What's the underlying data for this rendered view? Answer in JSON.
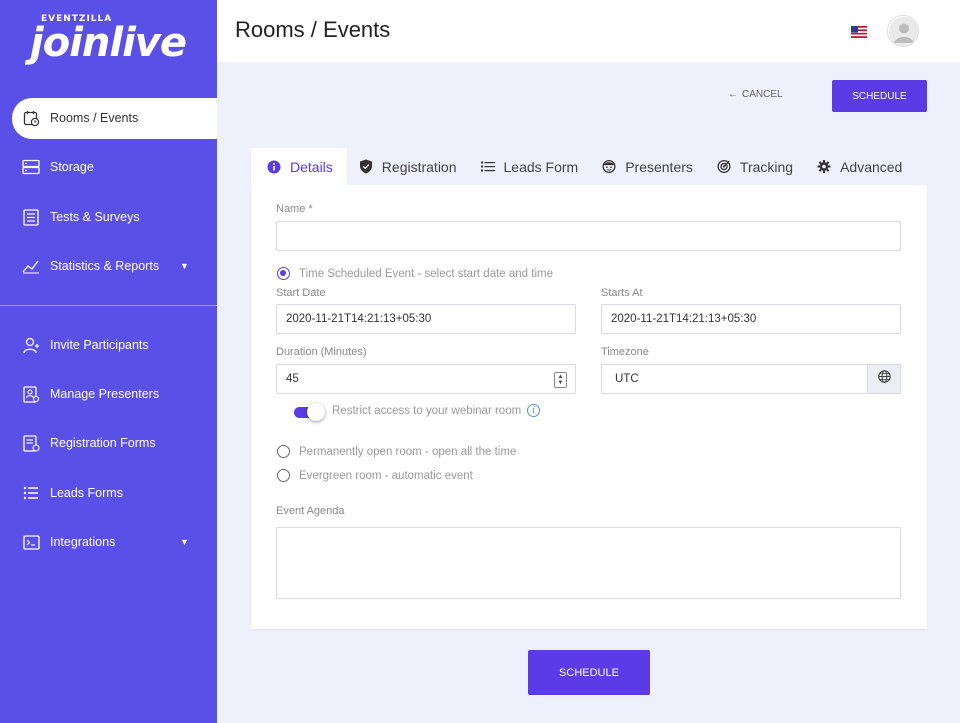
{
  "brand": {
    "small": "EVENTZILLA",
    "big": "joinlive"
  },
  "sidebar": {
    "items": [
      {
        "label": "Rooms / Events",
        "icon": "calendar-clock-icon"
      },
      {
        "label": "Storage",
        "icon": "storage-icon"
      },
      {
        "label": "Tests & Surveys",
        "icon": "checklist-icon"
      },
      {
        "label": "Statistics & Reports",
        "icon": "chart-icon"
      },
      {
        "label": "Invite Participants",
        "icon": "add-user-icon"
      },
      {
        "label": "Manage Presenters",
        "icon": "presenter-icon"
      },
      {
        "label": "Registration Forms",
        "icon": "form-icon"
      },
      {
        "label": "Leads Forms",
        "icon": "list-icon"
      },
      {
        "label": "Integrations",
        "icon": "terminal-icon"
      }
    ]
  },
  "header": {
    "title": "Rooms / Events"
  },
  "actions": {
    "cancel": "CANCEL",
    "schedule": "SCHEDULE"
  },
  "tabs": [
    {
      "label": "Details",
      "icon": "info-icon"
    },
    {
      "label": "Registration",
      "icon": "shield-icon"
    },
    {
      "label": "Leads Form",
      "icon": "list-icon"
    },
    {
      "label": "Presenters",
      "icon": "face-icon"
    },
    {
      "label": "Tracking",
      "icon": "tracking-icon"
    },
    {
      "label": "Advanced",
      "icon": "gear-icon"
    }
  ],
  "form": {
    "name_label": "Name *",
    "name_value": "",
    "opt_scheduled": "Time Scheduled Event - select start date and time",
    "start_date_label": "Start Date",
    "start_date_value": "2020-11-21T14:21:13+05:30",
    "starts_at_label": "Starts At",
    "starts_at_value": "2020-11-21T14:21:13+05:30",
    "duration_label": "Duration (Minutes)",
    "duration_value": "45",
    "timezone_label": "Timezone",
    "timezone_value": "UTC",
    "restrict_label": "Restrict access to your webinar room",
    "opt_permanent": "Permanently open room - open all the time",
    "opt_evergreen": "Evergreen room - automatic event",
    "agenda_label": "Event Agenda",
    "agenda_value": ""
  },
  "colors": {
    "primary": "#5a3be6",
    "sidebar": "#5a4fe6",
    "background": "#eef0fb"
  }
}
